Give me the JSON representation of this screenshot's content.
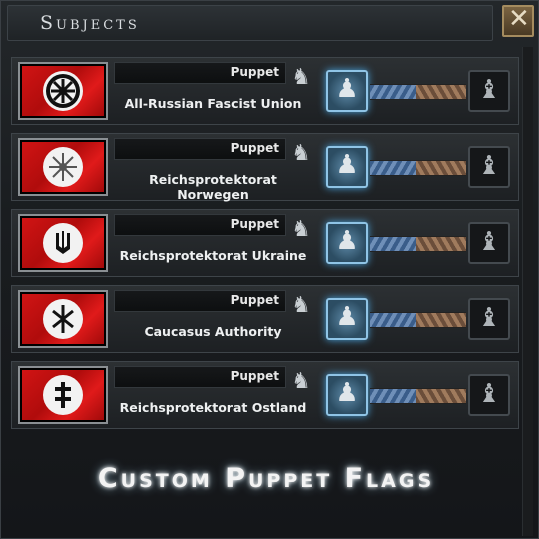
{
  "window": {
    "title": "Subjects",
    "close_label": "✕"
  },
  "subjects": [
    {
      "status": "Puppet",
      "name": "All-Russian Fascist Union",
      "emblem": "kolovrat-icon"
    },
    {
      "status": "Puppet",
      "name": "Reichsprotektorat Norwegen",
      "emblem": "vegvisir-icon"
    },
    {
      "status": "Puppet",
      "name": "Reichsprotektorat Ukraine",
      "emblem": "tryzub-icon"
    },
    {
      "status": "Puppet",
      "name": "Caucasus Authority",
      "emblem": "rune-icon"
    },
    {
      "status": "Puppet",
      "name": "Reichsprotektorat Ostland",
      "emblem": "double-cross-icon"
    }
  ],
  "icons": {
    "knight": "♞",
    "pawn": "♟",
    "bishop": "♝"
  },
  "caption": "Custom Puppet Flags",
  "colors": {
    "flag_red": "#c81414",
    "pawn_glow": "#4aa3dc"
  }
}
